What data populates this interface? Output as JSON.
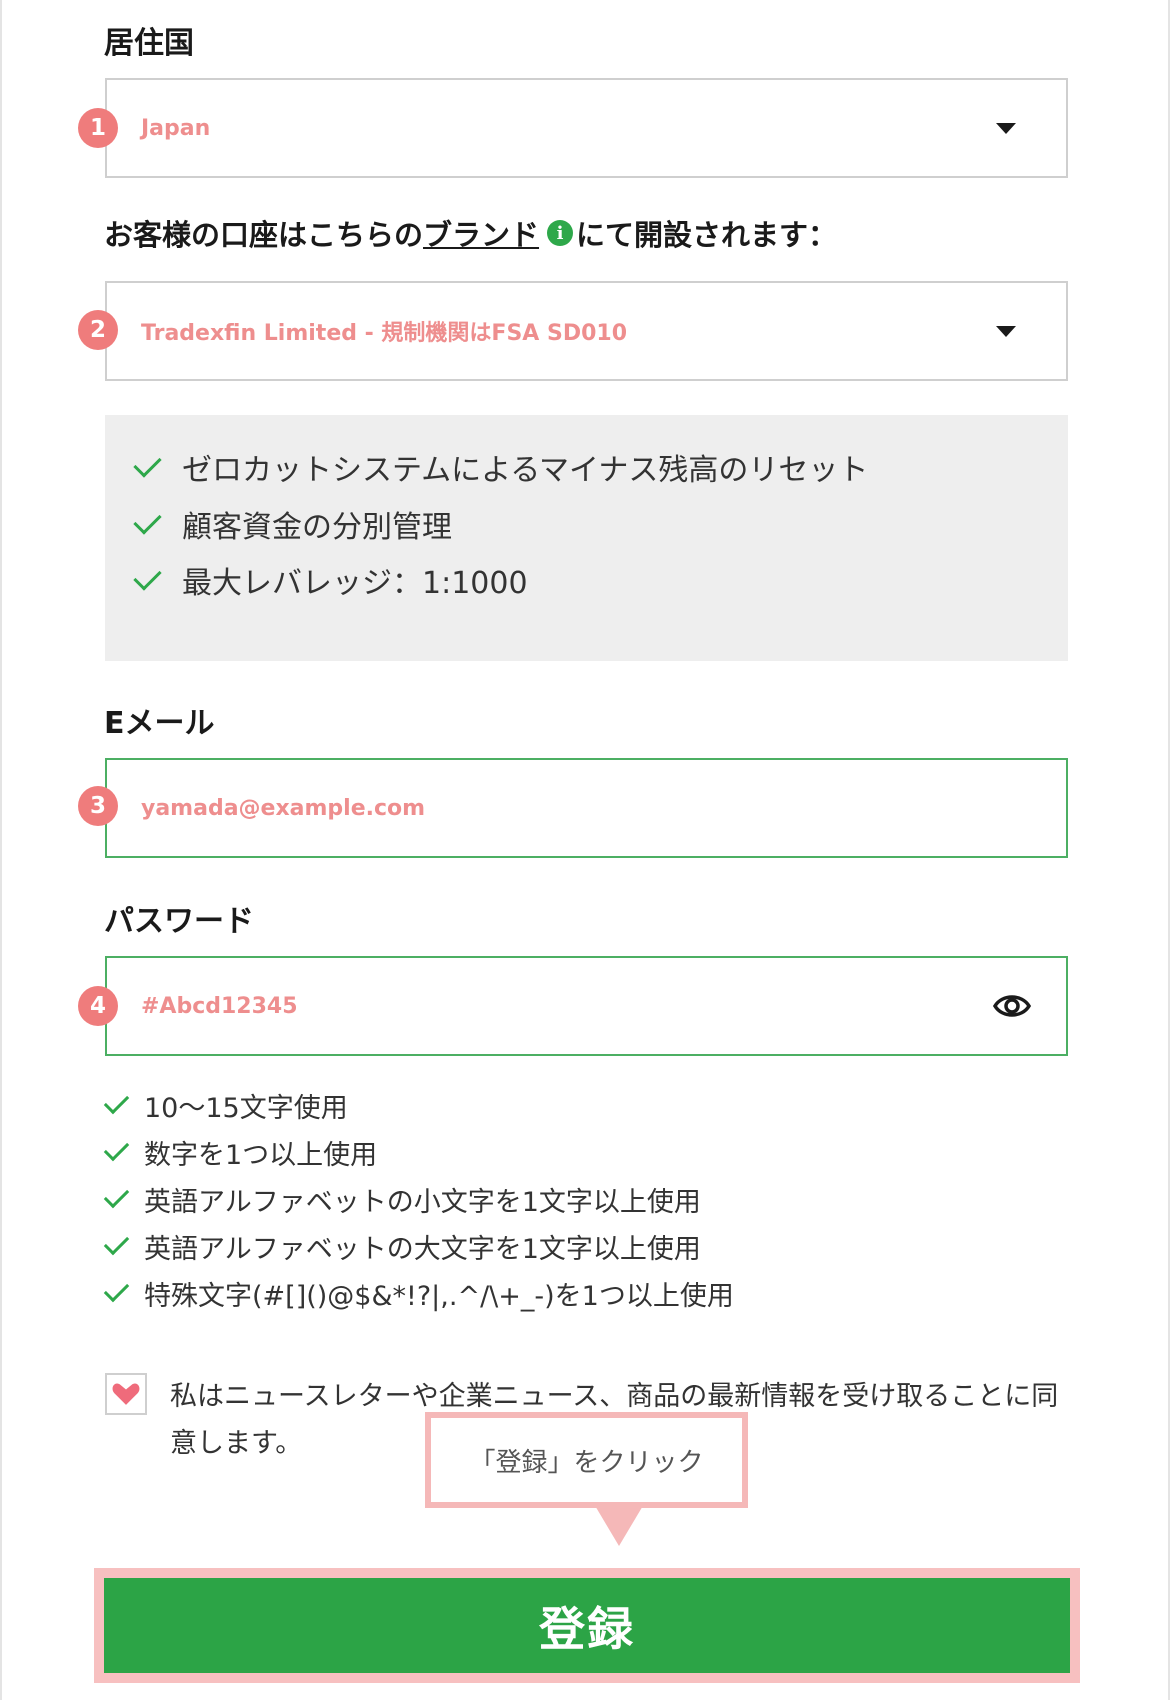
{
  "country": {
    "label": "居住国",
    "badge": "1",
    "value": "Japan"
  },
  "brand": {
    "label_prefix": "お客様の口座はこちらの",
    "label_link": "ブランド",
    "label_suffix": "にて開設されます：",
    "badge": "2",
    "value": "Tradexfin Limited - 規制機関はFSA SD010"
  },
  "features": [
    "ゼロカットシステムによるマイナス残高のリセット",
    "顧客資金の分別管理",
    "最大レバレッジ：1:1000"
  ],
  "email": {
    "label": "Eメール",
    "badge": "3",
    "value": "yamada@example.com"
  },
  "password": {
    "label": "パスワード",
    "badge": "4",
    "value": "#Abcd12345",
    "rules": [
      "10～15文字使用",
      "数字を1つ以上使用",
      "英語アルファベットの小文字を1文字以上使用",
      "英語アルファベットの大文字を1文字以上使用",
      "特殊文字(#[]()@$&*!?|,.^/\\+_-)を1つ以上使用"
    ]
  },
  "consent": {
    "text": "私はニュースレターや企業ニュース、商品の最新情報を受け取ることに同意します。",
    "checked": true
  },
  "tooltip": {
    "text": "「登録」をクリック"
  },
  "register": {
    "label": "登録"
  },
  "colors": {
    "accent_green": "#2ca446",
    "badge_red": "#ef7c7c",
    "highlight_pink": "#f7c0c0"
  }
}
